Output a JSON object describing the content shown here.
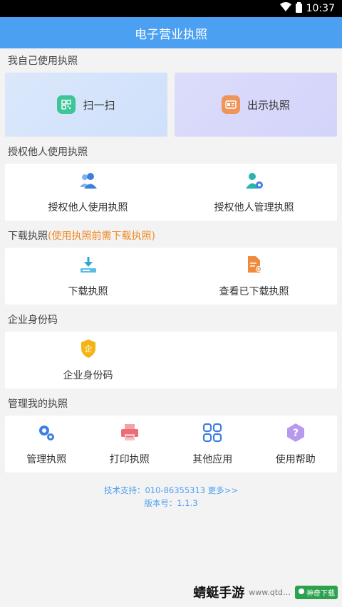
{
  "status": {
    "time": "10:37"
  },
  "appbar": {
    "title": "电子营业执照"
  },
  "section_self": {
    "title": "我自己使用执照",
    "scan_label": "扫一扫",
    "show_label": "出示执照"
  },
  "section_auth": {
    "title": "授权他人使用执照",
    "items": [
      {
        "label": "授权他人使用执照"
      },
      {
        "label": "授权他人管理执照"
      }
    ]
  },
  "section_download": {
    "title": "下载执照",
    "note": "(使用执照前需下载执照)",
    "items": [
      {
        "label": "下载执照"
      },
      {
        "label": "查看已下载执照"
      }
    ]
  },
  "section_id": {
    "title": "企业身份码",
    "items": [
      {
        "label": "企业身份码"
      }
    ]
  },
  "section_manage": {
    "title": "管理我的执照",
    "items": [
      {
        "label": "管理执照"
      },
      {
        "label": "打印执照"
      },
      {
        "label": "其他应用"
      },
      {
        "label": "使用帮助"
      }
    ]
  },
  "footer": {
    "support": "技术支持：010-86355313 更多>>",
    "version": "版本号：1.1.3"
  },
  "watermark": {
    "text": "蜻蜓手游",
    "sub": "www.qtd…",
    "badge": "神奇下载"
  },
  "colors": {
    "primary": "#4ba0f2",
    "accent": "#f08a24",
    "scan_badge": "#3ec59a",
    "show_badge": "#f0955a"
  }
}
